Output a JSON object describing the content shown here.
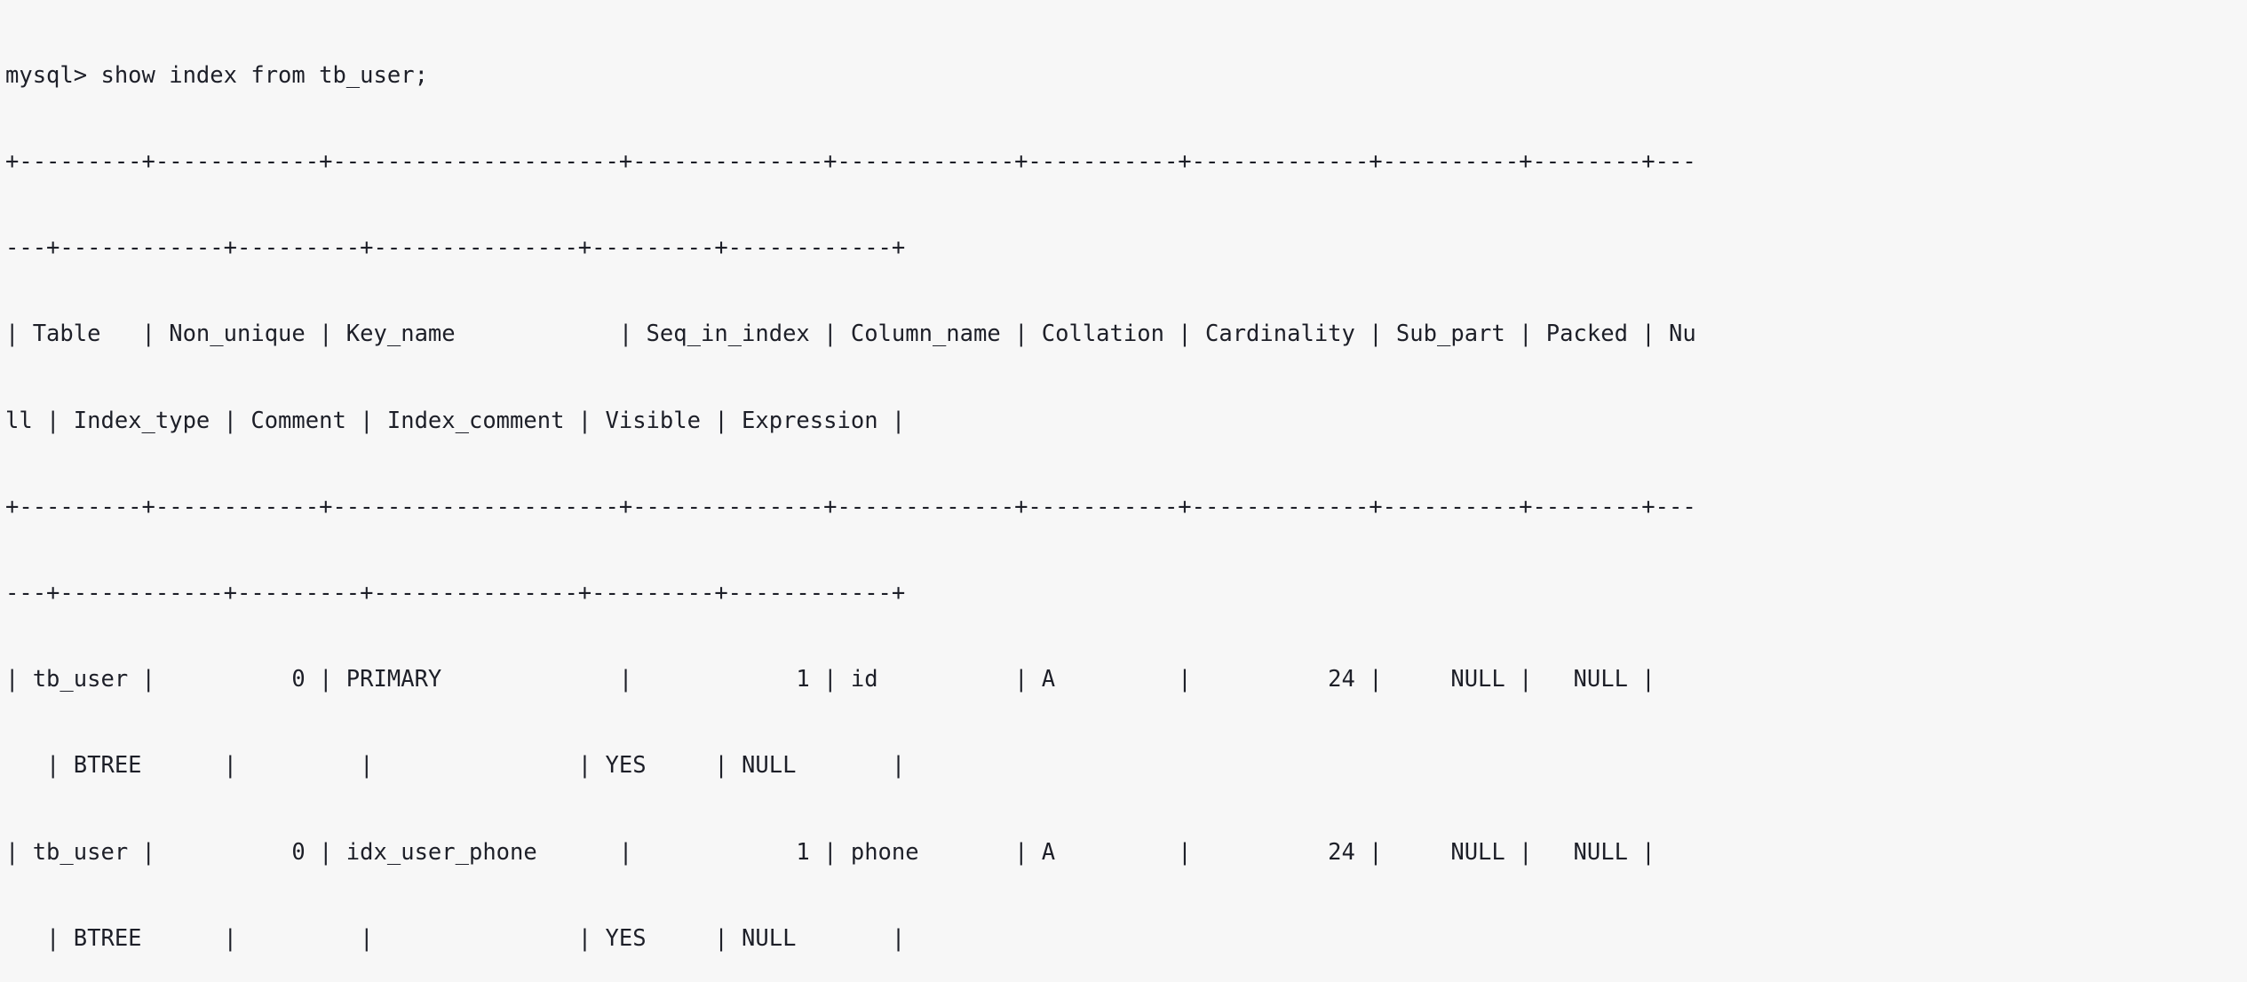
{
  "terminal": {
    "prompt": "mysql>",
    "command": "show index from tb_user;",
    "command_line": "mysql> show index from tb_user;",
    "background_color": "#f7f7f7",
    "text_color": "#1d1f28",
    "statement": {
      "verb": "show",
      "object": "index",
      "from_keyword": "from",
      "table": "tb_user",
      "terminator": ";"
    },
    "table_output": {
      "separator_line_full": "+---------+------------+---------------------+--------------+-------------+-----------+-------------+----------+--------+------+------------+---------+---------------+---------+------------+",
      "separator_segment_1": "+---------+------------+---------------------+--------------+-------------+-----------+-------------+----------+--------+---",
      "separator_segment_2": "---+------------+---------+---------------+---------+------------+",
      "header_segment_1": "| Table   | Non_unique | Key_name            | Seq_in_index | Column_name | Collation | Cardinality | Sub_part | Packed | Nu",
      "header_segment_2": "ll | Index_type | Comment | Index_comment | Visible | Expression |",
      "columns": [
        "Table",
        "Non_unique",
        "Key_name",
        "Seq_in_index",
        "Column_name",
        "Collation",
        "Cardinality",
        "Sub_part",
        "Packed",
        "Null",
        "Index_type",
        "Comment",
        "Index_comment",
        "Visible",
        "Expression"
      ],
      "rows": [
        {
          "segment_1": "| tb_user |          0 | PRIMARY             |            1 | id          | A         |          24 |     NULL |   NULL |   ",
          "segment_2": "   | BTREE      |         |               | YES     | NULL       |",
          "values": {
            "Table": "tb_user",
            "Non_unique": "0",
            "Key_name": "PRIMARY",
            "Seq_in_index": "1",
            "Column_name": "id",
            "Collation": "A",
            "Cardinality": "24",
            "Sub_part": "NULL",
            "Packed": "NULL",
            "Null": "",
            "Index_type": "BTREE",
            "Comment": "",
            "Index_comment": "",
            "Visible": "YES",
            "Expression": "NULL"
          }
        },
        {
          "segment_1": "| tb_user |          0 | idx_user_phone      |            1 | phone       | A         |          24 |     NULL |   NULL |   ",
          "segment_2": "   | BTREE      |         |               | YES     | NULL       |",
          "values": {
            "Table": "tb_user",
            "Non_unique": "0",
            "Key_name": "idx_user_phone",
            "Seq_in_index": "1",
            "Column_name": "phone",
            "Collation": "A",
            "Cardinality": "24",
            "Sub_part": "NULL",
            "Packed": "NULL",
            "Null": "",
            "Index_type": "BTREE",
            "Comment": "",
            "Index_comment": "",
            "Visible": "YES",
            "Expression": "NULL"
          }
        }
      ]
    },
    "lines": [
      "mysql> show index from tb_user;",
      "+---------+------------+---------------------+--------------+-------------+-----------+-------------+----------+--------+---",
      "---+------------+---------+---------------+---------+------------+",
      "| Table   | Non_unique | Key_name            | Seq_in_index | Column_name | Collation | Cardinality | Sub_part | Packed | Nu",
      "ll | Index_type | Comment | Index_comment | Visible | Expression |",
      "+---------+------------+---------------------+--------------+-------------+-----------+-------------+----------+--------+---",
      "---+------------+---------+---------------+---------+------------+",
      "| tb_user |          0 | PRIMARY             |            1 | id          | A         |          24 |     NULL |   NULL |",
      "   | BTREE      |         |               | YES     | NULL       |",
      "| tb_user |          0 | idx_user_phone      |            1 | phone       | A         |          24 |     NULL |   NULL |",
      "   | BTREE      |         |               | YES     | NULL       |"
    ]
  }
}
